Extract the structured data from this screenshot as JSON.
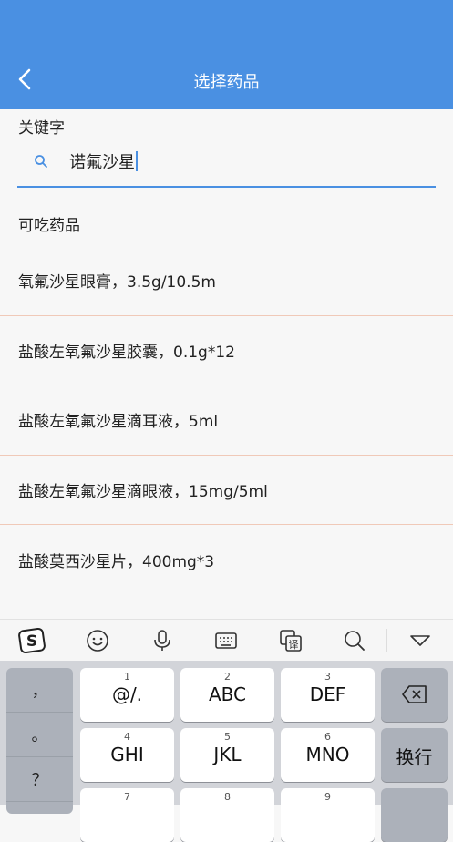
{
  "nav": {
    "title": "选择药品"
  },
  "keyword": {
    "label": "关键字",
    "value": "诺氟沙星"
  },
  "section": {
    "label": "可吃药品"
  },
  "drugs": [
    "氧氟沙星眼膏，3.5g/10.5m",
    "盐酸左氧氟沙星胶囊，0.1g*12",
    "盐酸左氧氟沙星滴耳液，5ml",
    "盐酸左氧氟沙星滴眼液，15mg/5ml",
    "盐酸莫西沙星片，400mg*3"
  ],
  "keyboard": {
    "left_column": [
      "，",
      "。",
      "？"
    ],
    "keys": [
      {
        "num": "1",
        "label": "@/."
      },
      {
        "num": "2",
        "label": "ABC"
      },
      {
        "num": "3",
        "label": "DEF"
      },
      {
        "num": "4",
        "label": "GHI"
      },
      {
        "num": "5",
        "label": "JKL"
      },
      {
        "num": "6",
        "label": "MNO"
      },
      {
        "num": "7",
        "label": ""
      },
      {
        "num": "8",
        "label": ""
      },
      {
        "num": "9",
        "label": ""
      }
    ],
    "enter_label": "换行"
  },
  "colors": {
    "accent": "#4a90e2",
    "divider": "#f0c9b8"
  }
}
